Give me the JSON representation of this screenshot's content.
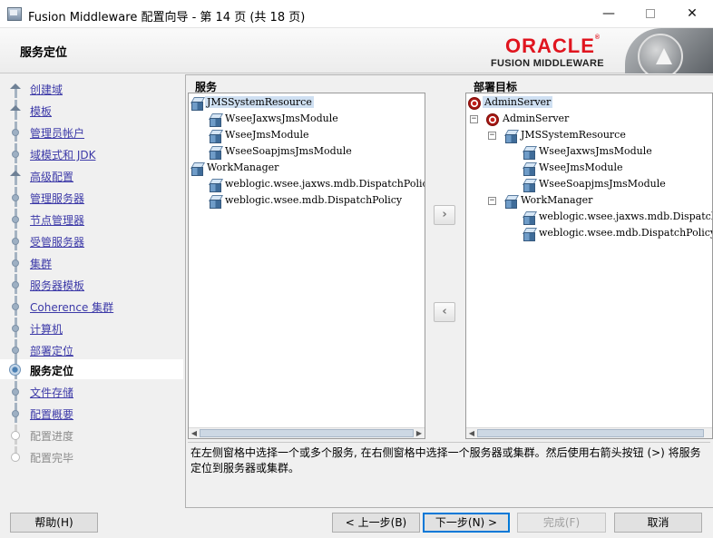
{
  "window": {
    "title": "Fusion Middleware 配置向导 - 第 14 页 (共 18 页)",
    "minimize": "—",
    "close": "✕"
  },
  "header": {
    "page_title": "服务定位",
    "logo_text": "ORACLE",
    "logo_mark": "®",
    "logo_subtitle": "FUSION MIDDLEWARE"
  },
  "steps": [
    {
      "label": "创建域",
      "state": "done"
    },
    {
      "label": "模板",
      "state": "done"
    },
    {
      "label": "管理员帐户",
      "state": "done"
    },
    {
      "label": "域模式和 JDK",
      "state": "done"
    },
    {
      "label": "高级配置",
      "state": "done"
    },
    {
      "label": "管理服务器",
      "state": "done"
    },
    {
      "label": "节点管理器",
      "state": "done"
    },
    {
      "label": "受管服务器",
      "state": "done"
    },
    {
      "label": "集群",
      "state": "done"
    },
    {
      "label": "服务器模板",
      "state": "done"
    },
    {
      "label": "Coherence 集群",
      "state": "done"
    },
    {
      "label": "计算机",
      "state": "done"
    },
    {
      "label": "部署定位",
      "state": "done"
    },
    {
      "label": "服务定位",
      "state": "current"
    },
    {
      "label": "文件存储",
      "state": "next"
    },
    {
      "label": "配置概要",
      "state": "next"
    },
    {
      "label": "配置进度",
      "state": "disabled"
    },
    {
      "label": "配置完毕",
      "state": "disabled"
    }
  ],
  "services_pane": {
    "label": "服务",
    "items": [
      {
        "text": "JMSSystemResource",
        "selected": true
      },
      {
        "text": "WseeJaxwsJmsModule"
      },
      {
        "text": "WseeJmsModule"
      },
      {
        "text": "WseeSoapjmsJmsModule"
      },
      {
        "text": "WorkManager"
      },
      {
        "text": "weblogic.wsee.jaxws.mdb.DispatchPolicy"
      },
      {
        "text": "weblogic.wsee.mdb.DispatchPolicy"
      }
    ]
  },
  "targets_pane": {
    "label": "部署目标",
    "items": [
      {
        "text": "AdminServer",
        "selected": true
      },
      {
        "text": "AdminServer"
      },
      {
        "text": "JMSSystemResource"
      },
      {
        "text": "WseeJaxwsJmsModule"
      },
      {
        "text": "WseeJmsModule"
      },
      {
        "text": "WseeSoapjmsJmsModule"
      },
      {
        "text": "WorkManager"
      },
      {
        "text": "weblogic.wsee.jaxws.mdb.DispatchPolicy"
      },
      {
        "text": "weblogic.wsee.mdb.DispatchPolicy"
      }
    ]
  },
  "controls": {
    "move_right": "›",
    "move_left": "‹",
    "expand_minus": "−"
  },
  "help_text": "在左侧窗格中选择一个或多个服务, 在右侧窗格中选择一个服务器或集群。然后使用右箭头按钮 (>) 将服务定位到服务器或集群。",
  "buttons": {
    "help": "帮助(H)",
    "back": "< 上一步(B)",
    "next": "下一步(N) >",
    "finish": "完成(F)",
    "cancel": "取消"
  }
}
